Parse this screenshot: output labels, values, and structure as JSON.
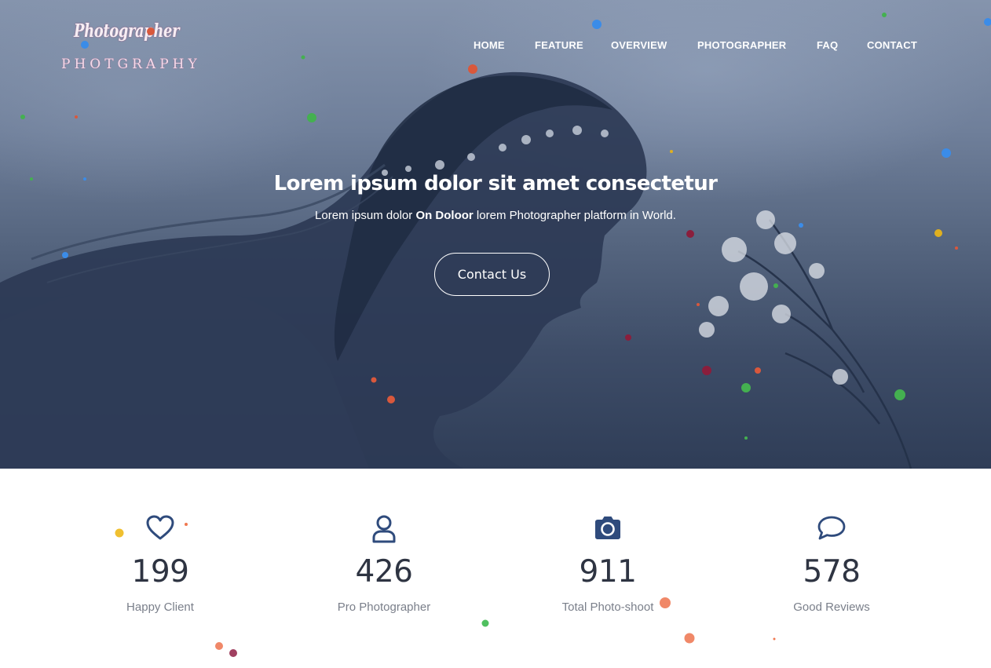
{
  "brand": {
    "logo_script": "Photographer",
    "logo_sub": "PHOTGRAPHY"
  },
  "nav": {
    "items": [
      {
        "label": "HOME"
      },
      {
        "label": "FEATURE"
      },
      {
        "label": "OVERVIEW"
      },
      {
        "label": "PHOTOGRAPHER"
      },
      {
        "label": "FAQ"
      },
      {
        "label": "CONTACT"
      }
    ]
  },
  "hero": {
    "title": "Lorem ipsum dolor sit amet consectetur",
    "subtitle_pre": "Lorem ipsum dolor ",
    "subtitle_bold": "On Doloor",
    "subtitle_post": " lorem Photographer platform in World.",
    "cta_label": "Contact Us"
  },
  "stats": [
    {
      "icon": "heart-icon",
      "value": "199",
      "label": "Happy Client"
    },
    {
      "icon": "user-icon",
      "value": "426",
      "label": "Pro Photographer"
    },
    {
      "icon": "camera-icon",
      "value": "911",
      "label": "Total Photo-shoot"
    },
    {
      "icon": "chat-bubble-icon",
      "value": "578",
      "label": "Good Reviews"
    }
  ],
  "colors": {
    "accent_icon": "#2f4b7c",
    "hero_overlay": "#3e4d68",
    "stat_number": "#2e3442",
    "stat_label": "#7a7f8a"
  }
}
